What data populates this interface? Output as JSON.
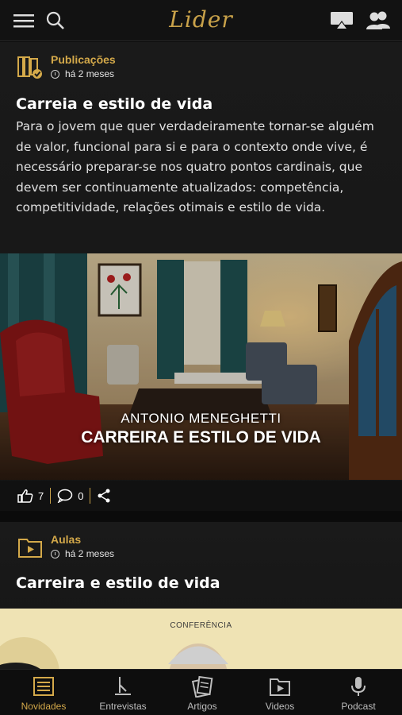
{
  "app": {
    "logo_text": "Lider"
  },
  "topbar": {
    "icons": [
      "menu-icon",
      "search-icon",
      "airplay-icon",
      "community-icon"
    ]
  },
  "feed": [
    {
      "category": "Publicações",
      "category_icon": "books-icon",
      "time": "há 2 meses",
      "title": "Carreia e estilo de vida",
      "description": "Para o jovem que quer verdadeiramente tornar-se alguém de valor, funcional para si e para o contexto onde vive, é necessário preparar-se nos quatro pontos cardinais, que devem ser continuamente atualizados: competência, competitividade, relações otimais e estilo de vida.",
      "image_caption_1": "ANTONIO MENEGHETTI",
      "image_caption_2": "CARREIRA E ESTILO DE VIDA",
      "likes": "7",
      "comments": "0"
    },
    {
      "category": "Aulas",
      "category_icon": "video-icon",
      "time": "há 2 meses",
      "title": "Carreira e estilo de vida",
      "image_caption": "CONFERÊNCIA"
    }
  ],
  "bottom_nav": [
    {
      "label": "Novidades",
      "icon": "news-icon",
      "active": true
    },
    {
      "label": "Entrevistas",
      "icon": "microphone-stand-icon",
      "active": false
    },
    {
      "label": "Artigos",
      "icon": "articles-icon",
      "active": false
    },
    {
      "label": "Videos",
      "icon": "video-play-icon",
      "active": false
    },
    {
      "label": "Podcast",
      "icon": "podcast-mic-icon",
      "active": false
    }
  ],
  "colors": {
    "accent": "#d4a94a",
    "background": "#0b0b0b",
    "card": "#1a1a1a"
  }
}
